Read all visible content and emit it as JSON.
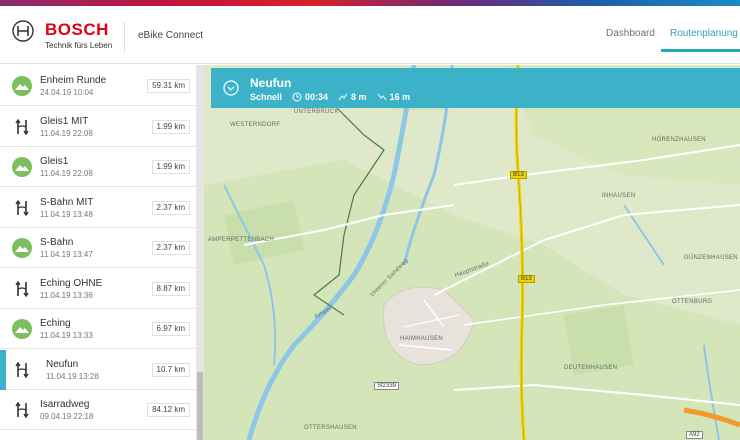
{
  "header": {
    "brand": "BOSCH",
    "tagline": "Technik fürs Leben",
    "app_name": "eBike Connect",
    "nav": [
      {
        "label": "Dashboard",
        "active": false
      },
      {
        "label": "Routenplanung",
        "active": true
      }
    ]
  },
  "routes": [
    {
      "name": "Enheim Runde",
      "date": "24.04.19 10:04",
      "distance": "59.31 km",
      "icon": "hill-icon",
      "selected": false
    },
    {
      "name": "Gleis1 MIT",
      "date": "11.04.19 22:08",
      "distance": "1.99 km",
      "icon": "route-arrows-icon",
      "selected": false
    },
    {
      "name": "Gleis1",
      "date": "11.04.19 22:08",
      "distance": "1.99 km",
      "icon": "hill-icon",
      "selected": false
    },
    {
      "name": "S-Bahn MIT",
      "date": "11.04.19 13:48",
      "distance": "2.37 km",
      "icon": "route-arrows-icon",
      "selected": false
    },
    {
      "name": "S-Bahn",
      "date": "11.04.19 13:47",
      "distance": "2.37 km",
      "icon": "hill-icon",
      "selected": false
    },
    {
      "name": "Eching OHNE",
      "date": "11.04.19 13:36",
      "distance": "8.87 km",
      "icon": "route-arrows-icon",
      "selected": false
    },
    {
      "name": "Eching",
      "date": "11.04.19 13:33",
      "distance": "6.97 km",
      "icon": "hill-icon",
      "selected": false
    },
    {
      "name": "Neufun",
      "date": "11.04.19 13:28",
      "distance": "10.7 km",
      "icon": "route-arrows-icon",
      "selected": true
    },
    {
      "name": "Isarradweg",
      "date": "09.04.19 22:18",
      "distance": "84.12 km",
      "icon": "route-arrows-icon",
      "selected": false
    }
  ],
  "route_detail": {
    "title": "Neufun",
    "mode": "Schnell",
    "duration": "00:34",
    "ascent": "8 m",
    "descent": "16 m"
  },
  "map": {
    "labels": {
      "westerndorf": "WESTERNDORF",
      "ampertshausen": "AMPERPETTENBACH",
      "haimhausen": "HAIMHAUSEN",
      "ottershausen": "OTTERSHAUSEN",
      "hoerenzhausen": "HÖRENZHAUSEN",
      "guenzenhausen": "GÜNZENHAUSEN",
      "ottenburg": "OTTENBURG",
      "deutenhausen": "DEUTENHAUSEN",
      "inhausen": "INHAUSEN",
      "unterbruck": "UNTERBRÜCK"
    },
    "roads": {
      "b13a": "B13",
      "b13b": "B13",
      "st2339": "St2339",
      "a92": "A92",
      "haupt": "Hauptstraße",
      "unterer": "Unterer Sandweg",
      "amper": "Amper"
    }
  }
}
